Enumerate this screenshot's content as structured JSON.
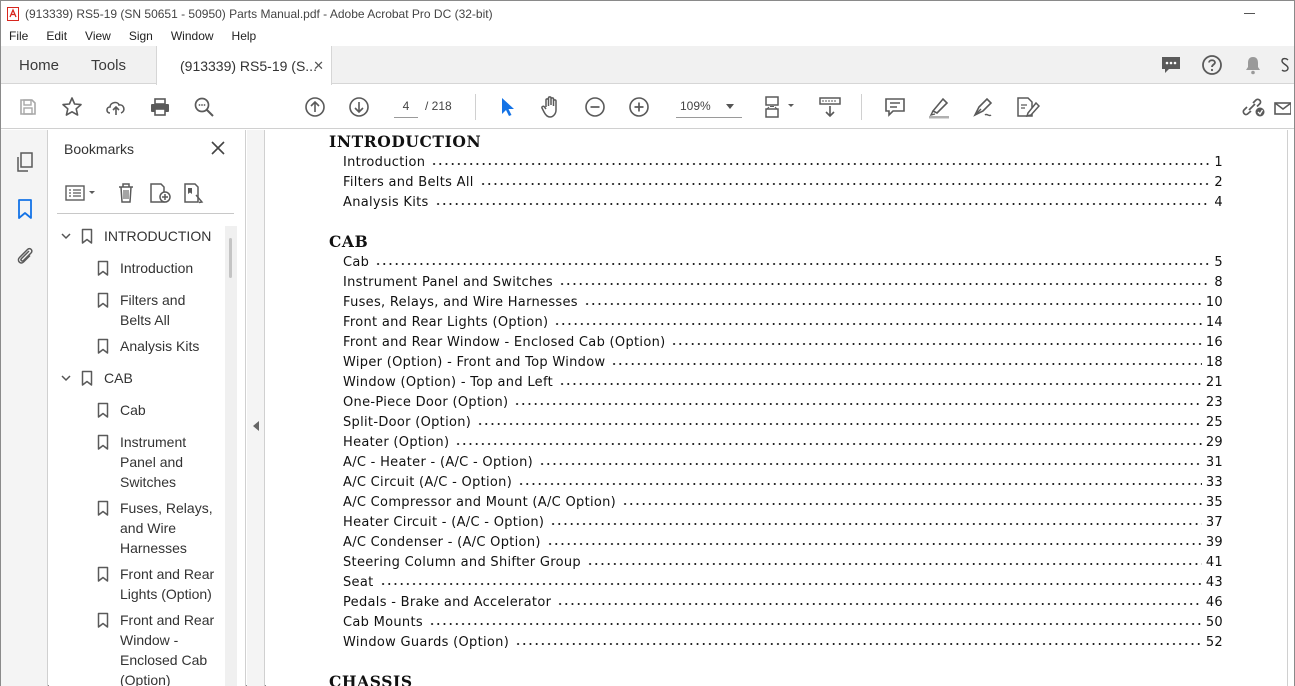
{
  "window": {
    "title": "(913339) RS5-19 (SN 50651 - 50950) Parts Manual.pdf - Adobe Acrobat Pro DC (32-bit)"
  },
  "menu": [
    "File",
    "Edit",
    "View",
    "Sign",
    "Window",
    "Help"
  ],
  "tabs": {
    "home": "Home",
    "tools": "Tools",
    "document": "(913339) RS5-19 (S...",
    "close": "✕"
  },
  "toolbar": {
    "page_current": "4",
    "page_total": "/  218",
    "zoom": "109%"
  },
  "bookmarks": {
    "title": "Bookmarks",
    "items": [
      {
        "label": "INTRODUCTION",
        "level": 0,
        "expanded": true
      },
      {
        "label": "Introduction",
        "level": 1
      },
      {
        "label": "Filters and\nBelts All",
        "level": 1
      },
      {
        "label": "Analysis Kits",
        "level": 1
      },
      {
        "label": "CAB",
        "level": 0,
        "expanded": true
      },
      {
        "label": "Cab",
        "level": 1
      },
      {
        "label": "Instrument\nPanel and\nSwitches",
        "level": 1
      },
      {
        "label": "Fuses, Relays,\nand Wire\nHarnesses",
        "level": 1
      },
      {
        "label": "Front and Rear\nLights (Option)",
        "level": 1
      },
      {
        "label": "Front and Rear\nWindow -\nEnclosed Cab\n(Option)",
        "level": 1
      }
    ]
  },
  "document": {
    "sections": [
      {
        "heading": "INTRODUCTION",
        "entries": [
          {
            "title": "Introduction",
            "page": "1"
          },
          {
            "title": "Filters and Belts All",
            "page": "2"
          },
          {
            "title": "Analysis Kits",
            "page": "4"
          }
        ]
      },
      {
        "heading": "CAB",
        "entries": [
          {
            "title": "Cab",
            "page": "5"
          },
          {
            "title": "Instrument Panel and Switches",
            "page": "8"
          },
          {
            "title": "Fuses, Relays, and Wire Harnesses",
            "page": "10"
          },
          {
            "title": "Front and Rear Lights (Option)",
            "page": "14"
          },
          {
            "title": "Front and Rear Window - Enclosed Cab (Option)",
            "page": "16"
          },
          {
            "title": "Wiper (Option) - Front and Top Window",
            "page": "18"
          },
          {
            "title": "Window (Option) - Top and Left",
            "page": "21"
          },
          {
            "title": "One-Piece Door (Option)",
            "page": "23"
          },
          {
            "title": "Split-Door (Option)",
            "page": "25"
          },
          {
            "title": "Heater (Option)",
            "page": "29"
          },
          {
            "title": "A/C - Heater - (A/C - Option)",
            "page": "31"
          },
          {
            "title": "A/C Circuit (A/C - Option)",
            "page": "33"
          },
          {
            "title": "A/C Compressor and Mount (A/C Option)",
            "page": "35"
          },
          {
            "title": "Heater Circuit - (A/C - Option)",
            "page": "37"
          },
          {
            "title": "A/C Condenser - (A/C Option)",
            "page": "39"
          },
          {
            "title": "Steering Column and Shifter Group",
            "page": "41"
          },
          {
            "title": "Seat",
            "page": "43"
          },
          {
            "title": "Pedals - Brake and Accelerator",
            "page": "46"
          },
          {
            "title": "Cab Mounts",
            "page": "50"
          },
          {
            "title": "Window Guards (Option)",
            "page": "52"
          }
        ]
      },
      {
        "heading": "CHASSIS",
        "entries": []
      }
    ]
  },
  "icons": {
    "accent": "#1473e6",
    "icon_gray": "#5a5a5a",
    "acrobat_red": "#d7261e"
  }
}
